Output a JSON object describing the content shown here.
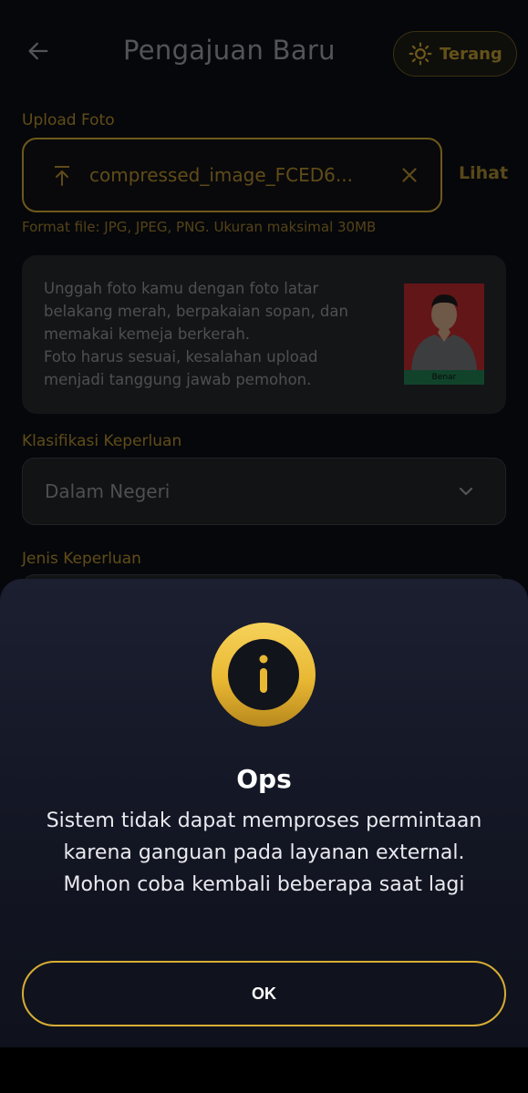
{
  "header": {
    "title": "Pengajuan Baru",
    "theme_label": "Terang"
  },
  "upload": {
    "label": "Upload Foto",
    "file_name": "compressed_image_FCED6...",
    "view_label": "Lihat",
    "hint": "Format file: JPG, JPEG, PNG. Ukuran maksimal 30MB"
  },
  "info_card": {
    "text_line1": "Unggah foto kamu dengan foto latar belakang merah, berpakaian sopan, dan memakai kemeja berkerah.",
    "text_line2": "Foto harus sesuai, kesalahan upload menjadi tanggung jawab pemohon.",
    "sample_caption": "Benar"
  },
  "classification": {
    "label": "Klasifikasi Keperluan",
    "value": "Dalam Negeri"
  },
  "purpose": {
    "label": "Jenis Keperluan"
  },
  "dialog": {
    "title": "Ops",
    "message": "Sistem tidak dapat memproses permintaan karena ganguan pada layanan external. Mohon coba kembali beberapa saat lagi",
    "ok_label": "OK"
  },
  "colors": {
    "accent": "#c9a232",
    "background": "#0c0e13",
    "sheet": "#151827"
  }
}
